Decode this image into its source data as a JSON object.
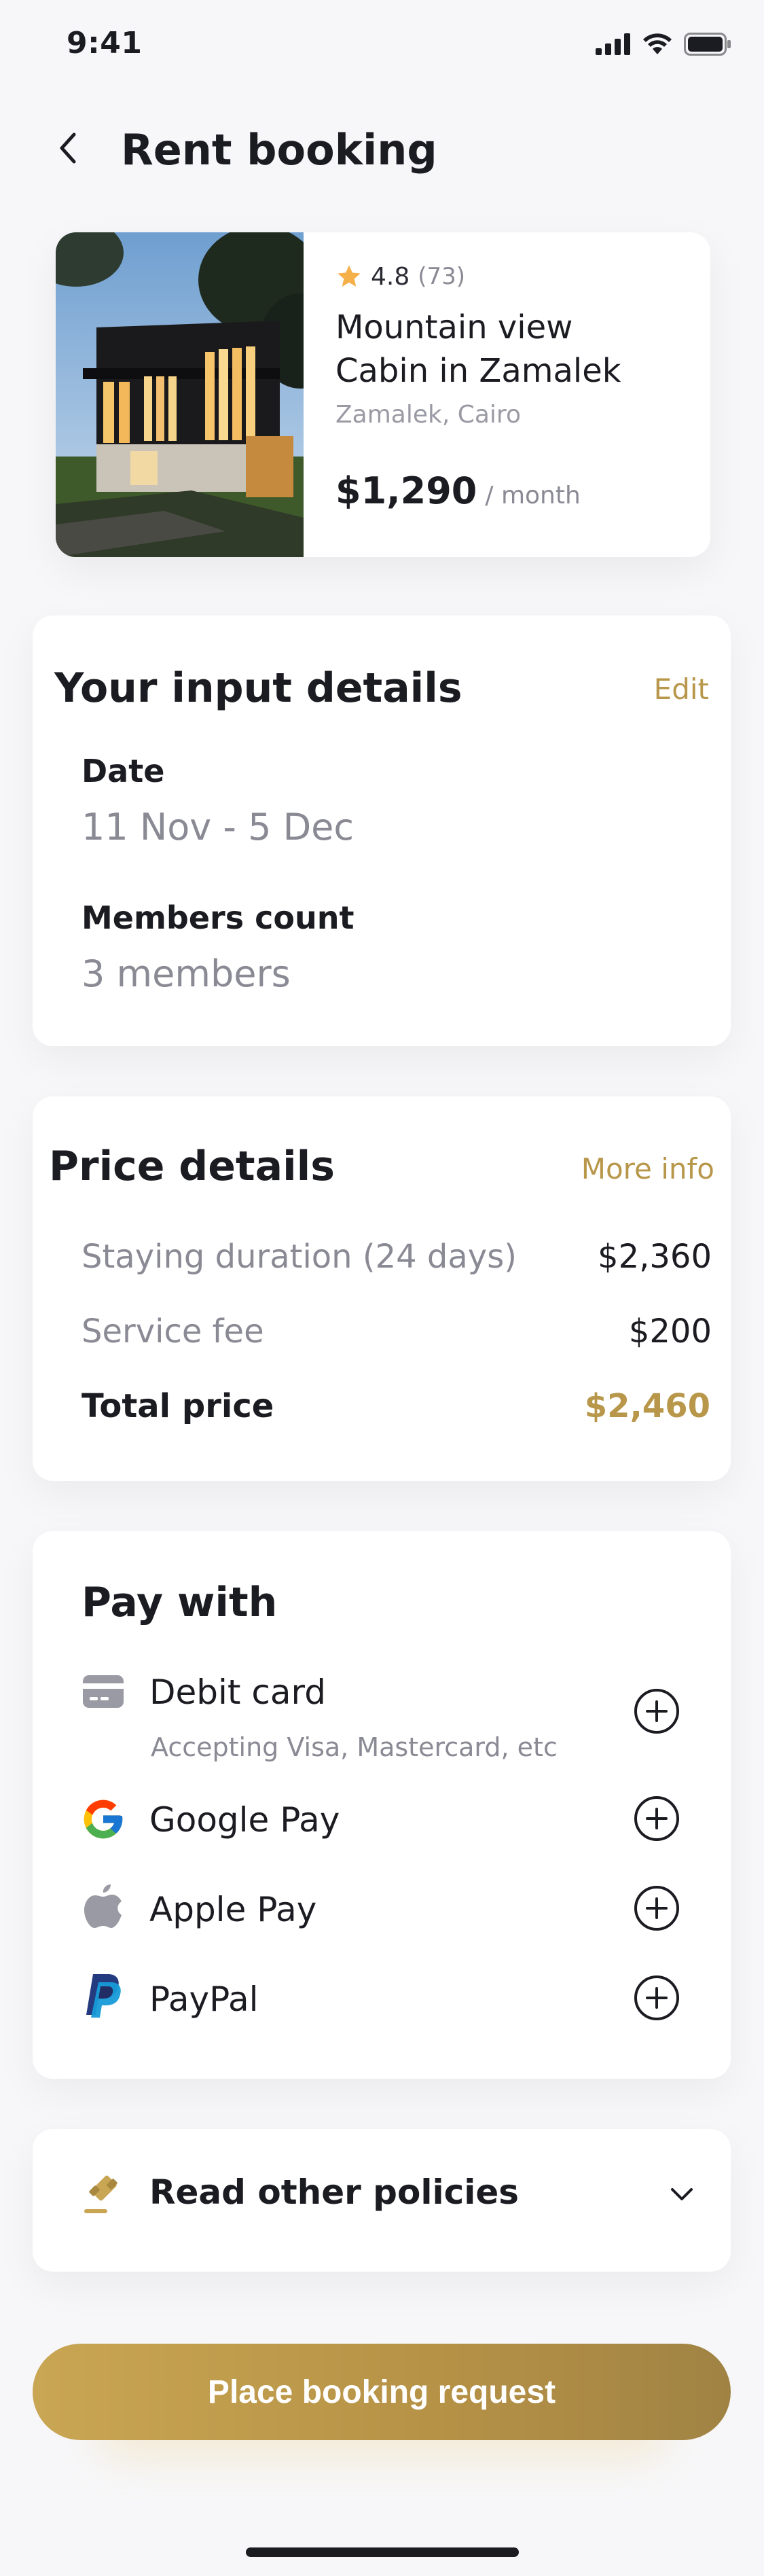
{
  "status_bar": {
    "time": "9:41"
  },
  "header": {
    "title": "Rent booking"
  },
  "property": {
    "rating": "4.8",
    "reviews": "(73)",
    "name_line1": "Mountain view",
    "name_line2": "Cabin in Zamalek",
    "location": "Zamalek, Cairo",
    "price": "$1,290",
    "price_unit": "/ month"
  },
  "input_details": {
    "title": "Your input details",
    "edit_label": "Edit",
    "date_label": "Date",
    "date_value": "11 Nov - 5 Dec",
    "members_label": "Members count",
    "members_value": "3 members"
  },
  "price_details": {
    "title": "Price details",
    "more_info_label": "More info",
    "lines": [
      {
        "label": "Staying duration (24 days)",
        "value": "$2,360"
      },
      {
        "label": "Service fee",
        "value": "$200"
      }
    ],
    "total_label": "Total price",
    "total_value": "$2,460"
  },
  "pay_with": {
    "title": "Pay with",
    "methods": [
      {
        "label": "Debit card",
        "sub": "Accepting Visa, Mastercard, etc",
        "icon": "card-icon"
      },
      {
        "label": "Google Pay",
        "icon": "google-icon"
      },
      {
        "label": "Apple Pay",
        "icon": "apple-icon"
      },
      {
        "label": "PayPal",
        "icon": "paypal-icon"
      }
    ]
  },
  "policies": {
    "label": "Read other policies"
  },
  "cta": {
    "label": "Place booking request"
  },
  "colors": {
    "accent": "#b8974a",
    "text": "#1b1b22",
    "muted": "#8a8a95",
    "background": "#f7f7f9"
  }
}
